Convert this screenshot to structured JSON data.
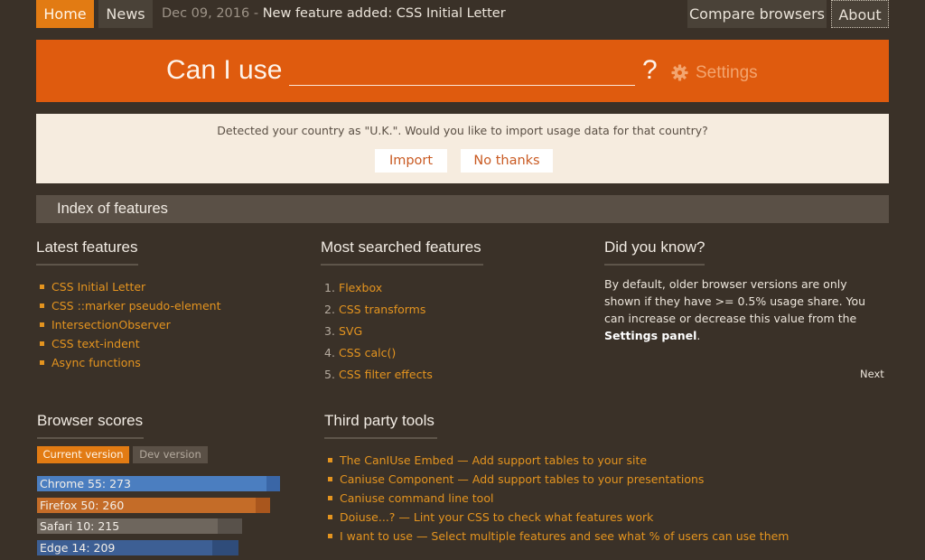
{
  "nav": {
    "home": "Home",
    "news": "News",
    "news_date": "Dec 09, 2016 -",
    "news_title": "New feature added: CSS Initial Letter",
    "compare": "Compare browsers",
    "about": "About"
  },
  "hero": {
    "label": "Can I use",
    "input_value": "",
    "question_mark": "?",
    "settings": "Settings"
  },
  "notice": {
    "text": "Detected your country as \"U.K.\". Would you like to import usage data for that country?",
    "import": "Import",
    "no_thanks": "No thanks"
  },
  "index_title": "Index of features",
  "latest": {
    "heading": "Latest features",
    "items": [
      "CSS Initial Letter",
      "CSS ::marker pseudo-element",
      "IntersectionObserver",
      "CSS text-indent",
      "Async functions"
    ]
  },
  "most_searched": {
    "heading": "Most searched features",
    "items": [
      {
        "num": "1.",
        "label": "Flexbox"
      },
      {
        "num": "2.",
        "label": "CSS transforms"
      },
      {
        "num": "3.",
        "label": "SVG"
      },
      {
        "num": "4.",
        "label": "CSS calc()"
      },
      {
        "num": "5.",
        "label": "CSS filter effects"
      }
    ]
  },
  "did_you_know": {
    "heading": "Did you know?",
    "text_before": "By default, older browser versions are only shown if they have >= 0.5% usage share. You can increase or decrease this value from the ",
    "text_strong": "Settings panel",
    "text_after": ".",
    "next": "Next"
  },
  "browser_scores": {
    "heading": "Browser scores",
    "tab_current": "Current version",
    "tab_dev": "Dev version",
    "rows": [
      {
        "label": "Chrome 55: 273",
        "score": 273,
        "max_score": 289,
        "fill": "#4b7ec0",
        "track": "#3a66a6"
      },
      {
        "label": "Firefox 50: 260",
        "score": 260,
        "max_score": 277,
        "fill": "#c46c28",
        "track": "#a9561d"
      },
      {
        "label": "Safari 10: 215",
        "score": 215,
        "max_score": 244,
        "fill": "#6e665d",
        "track": "#58514a"
      },
      {
        "label": "Edge 14: 209",
        "score": 209,
        "max_score": 240,
        "fill": "#3d5f94",
        "track": "#2f4c7a"
      }
    ]
  },
  "third_party": {
    "heading": "Third party tools",
    "items": [
      "The CanIUse Embed — Add support tables to your site",
      "Caniuse Component — Add support tables to your presentations",
      "Caniuse command line tool",
      "Doiuse...? — Lint your CSS to check what features work",
      "I want to use — Select multiple features and see what % of users can use them"
    ]
  }
}
